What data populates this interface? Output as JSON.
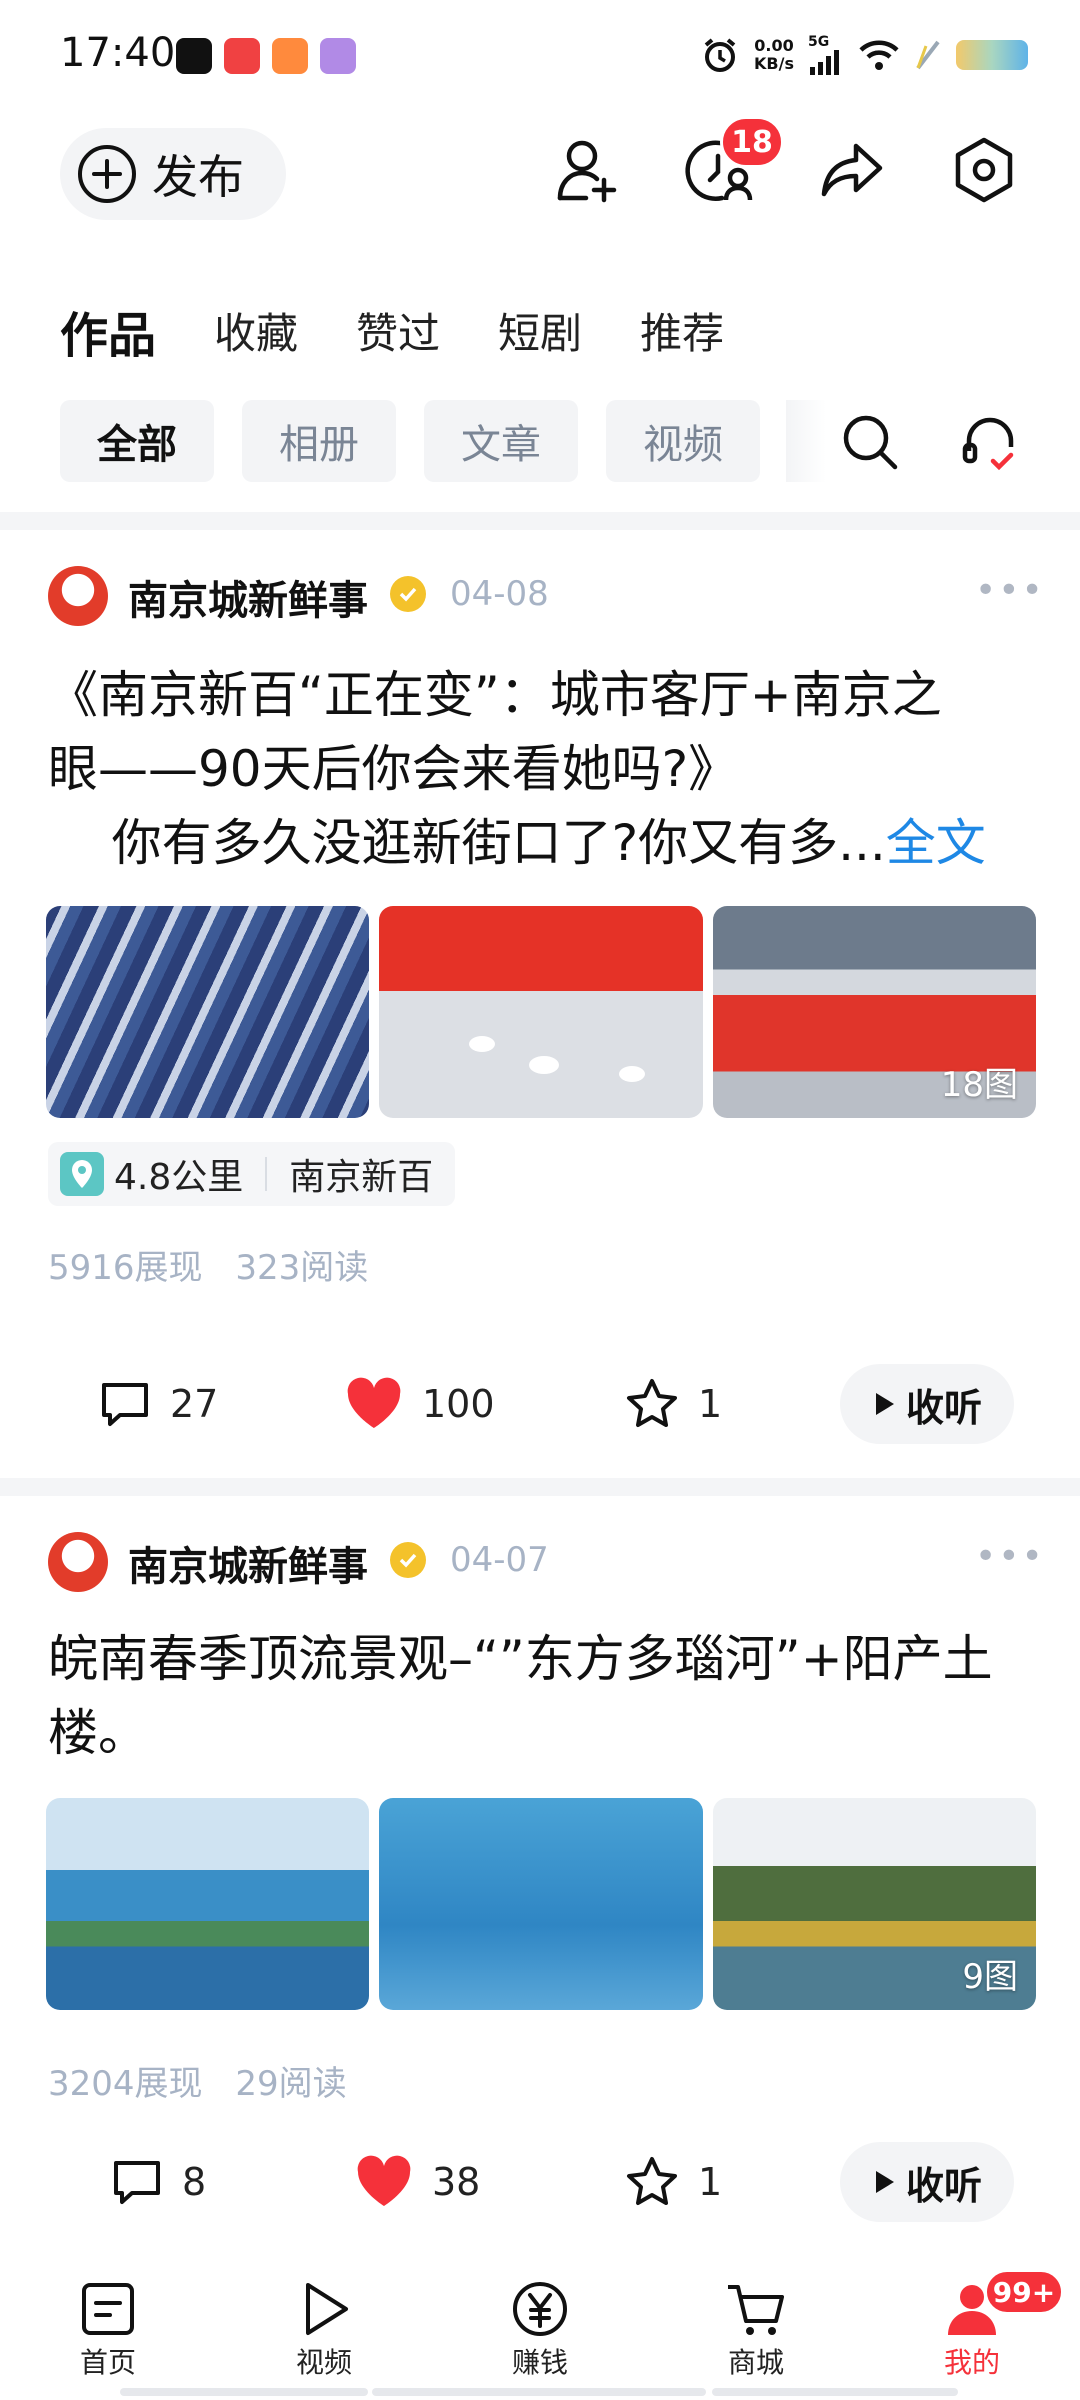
{
  "status_bar": {
    "time": "17:40",
    "net_speed_value": "0.00",
    "net_speed_unit": "KB/s",
    "network": "5G",
    "apps": [
      "tiktok-icon",
      "toutiao-icon",
      "fanqie-icon",
      "purple-app-icon"
    ]
  },
  "header": {
    "publish_label": "发布",
    "history_badge": "18"
  },
  "tabs": [
    "作品",
    "收藏",
    "赞过",
    "短剧",
    "推荐"
  ],
  "filters": [
    "全部",
    "相册",
    "文章",
    "视频"
  ],
  "posts": [
    {
      "author": "南京城新鲜事",
      "date": "04-08",
      "text_line1": "《南京新百“正在变”：城市客厅+南京之",
      "text_line2": "眼——90天后你会来看她吗?》",
      "text_line3": "    你有多久没逛新街口了?你又有多...",
      "full_text_link": "全文",
      "image_count": "18图",
      "location_distance": "4.8公里",
      "location_name": "南京新百",
      "views": "5916展现",
      "reads": "323阅读",
      "comments": "27",
      "likes": "100",
      "favorites": "1",
      "listen_label": "收听"
    },
    {
      "author": "南京城新鲜事",
      "date": "04-07",
      "text_line1": "皖南春季顶流景观–“”东方多瑙河”+阳产土",
      "text_line2": "楼。",
      "image_count": "9图",
      "views": "3204展现",
      "reads": "29阅读",
      "comments": "8",
      "likes": "38",
      "favorites": "1",
      "listen_label": "收听"
    }
  ],
  "bottom_nav": {
    "items": [
      "首页",
      "视频",
      "赚钱",
      "商城",
      "我的"
    ],
    "me_badge": "99+"
  },
  "colors": {
    "accent_red": "#f5313a",
    "link_blue": "#1e88e5",
    "muted_gray": "#a7b3c5"
  }
}
